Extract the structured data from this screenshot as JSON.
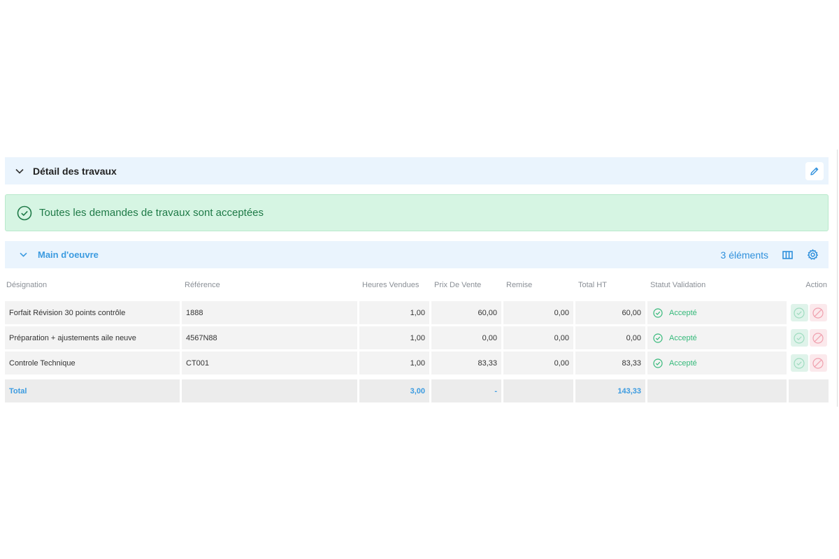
{
  "section": {
    "title": "Détail des travaux"
  },
  "alert": {
    "message": "Toutes les demandes de travaux sont acceptées"
  },
  "subsection": {
    "title": "Main d'oeuvre",
    "count_label": "3 éléments"
  },
  "table": {
    "columns": [
      "Désignation",
      "Référence",
      "Heures Vendues",
      "Prix De Vente",
      "Remise",
      "Total HT",
      "Statut Validation",
      "Action"
    ],
    "rows": [
      {
        "designation": "Forfait Révision 30 points contrôle",
        "reference": "1888",
        "heures": "1,00",
        "prix": "60,00",
        "remise": "0,00",
        "total": "60,00",
        "statut": "Accepté"
      },
      {
        "designation": "Préparation + ajustements aile neuve",
        "reference": "4567N88",
        "heures": "1,00",
        "prix": "0,00",
        "remise": "0,00",
        "total": "0,00",
        "statut": "Accepté"
      },
      {
        "designation": "Controle Technique",
        "reference": "CT001",
        "heures": "1,00",
        "prix": "83,33",
        "remise": "0,00",
        "total": "83,33",
        "statut": "Accepté"
      }
    ],
    "total": {
      "label": "Total",
      "heures": "3,00",
      "prix": "-",
      "total": "143,33"
    }
  },
  "colors": {
    "accent": "#3c9be0",
    "success": "#35b97a",
    "danger": "#f0a0ae",
    "header_bg": "#eaf4fd",
    "alert_bg": "#d6f5e3"
  },
  "icons": [
    "chevron-down-icon",
    "pencil-icon",
    "check-circle-icon",
    "columns-icon",
    "gear-icon",
    "ban-icon"
  ]
}
